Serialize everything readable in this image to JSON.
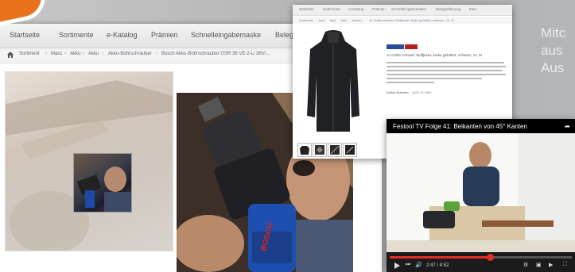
{
  "nav": {
    "items": [
      "Startseite",
      "Sortimente",
      "e-Katalog",
      "Prämien",
      "Schnelleingabemaske",
      "Belega"
    ]
  },
  "breadcrumb": {
    "items": [
      "Sortiment",
      "Masc",
      "Akku",
      "Akku",
      "Akku-Bohrschrauber",
      "Bosch Akku-Bohrschrauber GSR 36 VE-2-Li 36V/..."
    ]
  },
  "product_image": {
    "brand_text": "BOSCH"
  },
  "popup": {
    "nav_items": [
      "Startseite",
      "Sortimente",
      "e-Katalog",
      "Prämien",
      "Schnelleingabemaske",
      "Belegerfassung",
      "Mein"
    ],
    "crumbs": [
      "Sortiment",
      "Jack",
      "Jack",
      "Jack",
      "Jacken",
      "Jo Crafts schwarz Stoffjacke Jacke gefüttert, schwarz, Gr. M"
    ],
    "title": "Jo Crafts schwarz Stoffjacke Jacke gefüttert, schwarz, Gr. M",
    "price_label": "Artikel-Nummer",
    "price_value": "1524 12 1900"
  },
  "video": {
    "title": "Festool TV Folge 41: Beikanten von 45° Kanten",
    "time": "2:47 / 4:52",
    "progress_fraction": 0.55
  },
  "side_text": [
    "Mitc",
    "aus",
    "Aus"
  ],
  "colors": {
    "accent_orange": "#e8731c",
    "progress_red": "#e52d27"
  }
}
